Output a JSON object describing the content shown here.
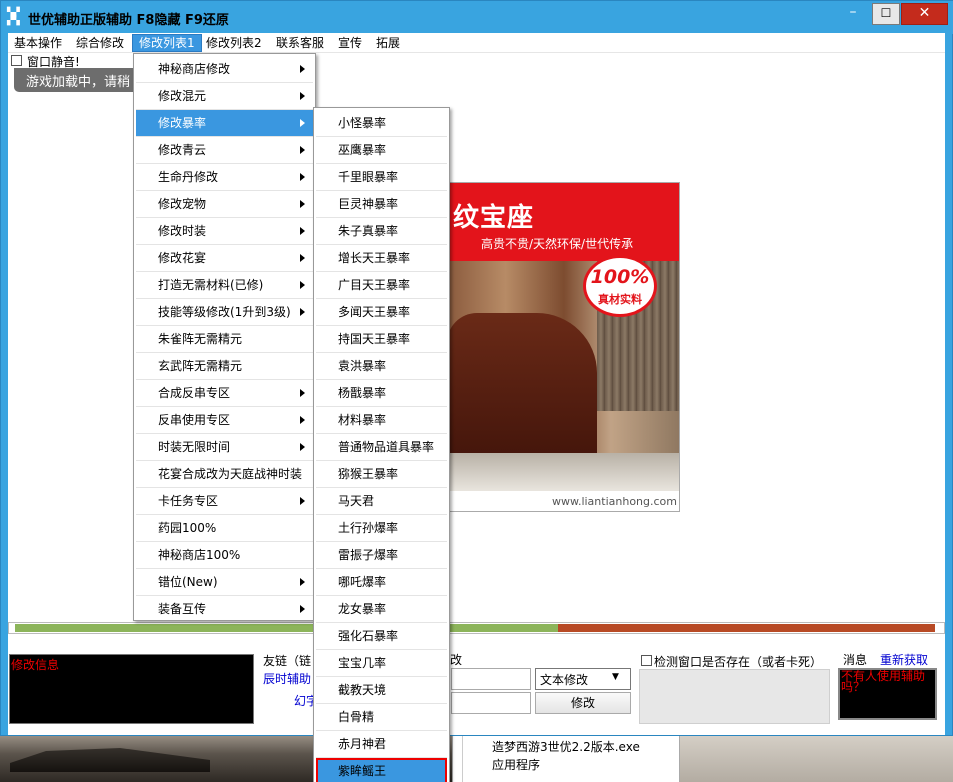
{
  "window": {
    "title": "世优辅助正版辅助  F8隐藏  F9还原",
    "app_icon": "app-icon",
    "controls": [
      "minimize",
      "maximize",
      "close"
    ],
    "close_glyph": "✕",
    "min_glyph": "–",
    "max_glyph": "☐"
  },
  "menubar": [
    "基本操作",
    "综合修改",
    "修改列表1",
    "修改列表2",
    "联系客服",
    "宣传",
    "拓展"
  ],
  "menubar_active_index": 2,
  "mute": {
    "label": "窗口静音!",
    "checked": false
  },
  "toast": "游戏加载中，请稍",
  "menu1": {
    "items": [
      {
        "label": "神秘商店修改",
        "submenu": true
      },
      {
        "label": "修改混元",
        "submenu": true
      },
      {
        "label": "修改暴率",
        "submenu": true,
        "selected": true
      },
      {
        "label": "修改青云",
        "submenu": true
      },
      {
        "label": "生命丹修改",
        "submenu": true
      },
      {
        "label": "修改宠物",
        "submenu": true
      },
      {
        "label": "修改时装",
        "submenu": true
      },
      {
        "label": "修改花宴",
        "submenu": true
      },
      {
        "label": "打造无需材料(已修)",
        "submenu": true
      },
      {
        "label": "技能等级修改(1升到3级)",
        "submenu": true
      },
      {
        "label": "朱雀阵无需精元",
        "submenu": false
      },
      {
        "label": "玄武阵无需精元",
        "submenu": false
      },
      {
        "label": "合成反串专区",
        "submenu": true
      },
      {
        "label": "反串使用专区",
        "submenu": true
      },
      {
        "label": "时装无限时间",
        "submenu": true
      },
      {
        "label": "花宴合成改为天庭战神时装",
        "submenu": false
      },
      {
        "label": "卡任务专区",
        "submenu": true
      },
      {
        "label": "药园100%",
        "submenu": false
      },
      {
        "label": "神秘商店100%",
        "submenu": false
      },
      {
        "label": "错位(New)",
        "submenu": true
      },
      {
        "label": "装备互传",
        "submenu": true
      }
    ]
  },
  "menu2": {
    "items": [
      {
        "label": "小怪暴率"
      },
      {
        "label": "巫鹰暴率"
      },
      {
        "label": "千里眼暴率"
      },
      {
        "label": "巨灵神暴率"
      },
      {
        "label": "朱子真暴率"
      },
      {
        "label": "增长天王暴率"
      },
      {
        "label": "广目天王暴率"
      },
      {
        "label": "多闻天王暴率"
      },
      {
        "label": "持国天王暴率"
      },
      {
        "label": "袁洪暴率"
      },
      {
        "label": "杨戬暴率"
      },
      {
        "label": "材料暴率"
      },
      {
        "label": "普通物品道具暴率"
      },
      {
        "label": "猕猴王暴率"
      },
      {
        "label": "马天君"
      },
      {
        "label": "土行孙爆率"
      },
      {
        "label": "雷振子爆率"
      },
      {
        "label": "哪吒爆率"
      },
      {
        "label": "龙女暴率"
      },
      {
        "label": "强化石暴率"
      },
      {
        "label": "宝宝几率"
      },
      {
        "label": "截教天境"
      },
      {
        "label": "白骨精"
      },
      {
        "label": "赤月神君"
      },
      {
        "label": "紫眸鳐王",
        "highlighted": true
      }
    ]
  },
  "ad": {
    "title": "纹宝座",
    "subtitle": "高贵不贵/天然环保/世代传承",
    "badge_number": "100%",
    "badge_text": "真材实料",
    "footer": "www.liantianhong.com",
    "accent": "#e3141b"
  },
  "progress": {
    "fraction": 0.59,
    "fill_color": "#8cb45a",
    "rest_color": "#b84a25"
  },
  "log": {
    "text": "修改信息"
  },
  "links": {
    "title": "友链（链",
    "link1": "辰时辅助",
    "link2": "幻字"
  },
  "edit": {
    "label": "改",
    "mode": "文本修改",
    "button": "修改"
  },
  "detect": {
    "label": "检测窗口是否存在（或者卡死）",
    "checked": false
  },
  "messages": {
    "label": "消息",
    "refresh": "重新获取",
    "text": "不有人使用辅助吗？"
  },
  "process": {
    "name": "造梦西游3世优2.2版本.exe",
    "type": "应用程序"
  },
  "colors": {
    "titlebar": "#39a4e0",
    "menu_highlight": "#3a97e0",
    "close": "#c42b1c",
    "link": "#0000d0",
    "error_text": "#e00000"
  }
}
